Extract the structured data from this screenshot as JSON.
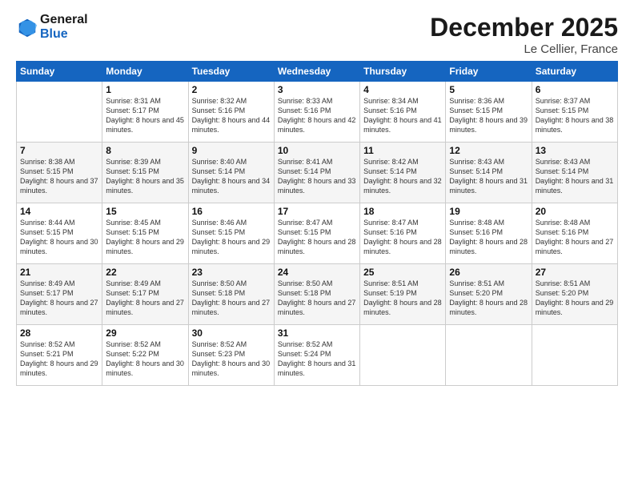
{
  "logo": {
    "line1": "General",
    "line2": "Blue"
  },
  "title": "December 2025",
  "location": "Le Cellier, France",
  "weekdays": [
    "Sunday",
    "Monday",
    "Tuesday",
    "Wednesday",
    "Thursday",
    "Friday",
    "Saturday"
  ],
  "weeks": [
    [
      {
        "day": "",
        "sunrise": "",
        "sunset": "",
        "daylight": ""
      },
      {
        "day": "1",
        "sunrise": "Sunrise: 8:31 AM",
        "sunset": "Sunset: 5:17 PM",
        "daylight": "Daylight: 8 hours and 45 minutes."
      },
      {
        "day": "2",
        "sunrise": "Sunrise: 8:32 AM",
        "sunset": "Sunset: 5:16 PM",
        "daylight": "Daylight: 8 hours and 44 minutes."
      },
      {
        "day": "3",
        "sunrise": "Sunrise: 8:33 AM",
        "sunset": "Sunset: 5:16 PM",
        "daylight": "Daylight: 8 hours and 42 minutes."
      },
      {
        "day": "4",
        "sunrise": "Sunrise: 8:34 AM",
        "sunset": "Sunset: 5:16 PM",
        "daylight": "Daylight: 8 hours and 41 minutes."
      },
      {
        "day": "5",
        "sunrise": "Sunrise: 8:36 AM",
        "sunset": "Sunset: 5:15 PM",
        "daylight": "Daylight: 8 hours and 39 minutes."
      },
      {
        "day": "6",
        "sunrise": "Sunrise: 8:37 AM",
        "sunset": "Sunset: 5:15 PM",
        "daylight": "Daylight: 8 hours and 38 minutes."
      }
    ],
    [
      {
        "day": "7",
        "sunrise": "Sunrise: 8:38 AM",
        "sunset": "Sunset: 5:15 PM",
        "daylight": "Daylight: 8 hours and 37 minutes."
      },
      {
        "day": "8",
        "sunrise": "Sunrise: 8:39 AM",
        "sunset": "Sunset: 5:15 PM",
        "daylight": "Daylight: 8 hours and 35 minutes."
      },
      {
        "day": "9",
        "sunrise": "Sunrise: 8:40 AM",
        "sunset": "Sunset: 5:14 PM",
        "daylight": "Daylight: 8 hours and 34 minutes."
      },
      {
        "day": "10",
        "sunrise": "Sunrise: 8:41 AM",
        "sunset": "Sunset: 5:14 PM",
        "daylight": "Daylight: 8 hours and 33 minutes."
      },
      {
        "day": "11",
        "sunrise": "Sunrise: 8:42 AM",
        "sunset": "Sunset: 5:14 PM",
        "daylight": "Daylight: 8 hours and 32 minutes."
      },
      {
        "day": "12",
        "sunrise": "Sunrise: 8:43 AM",
        "sunset": "Sunset: 5:14 PM",
        "daylight": "Daylight: 8 hours and 31 minutes."
      },
      {
        "day": "13",
        "sunrise": "Sunrise: 8:43 AM",
        "sunset": "Sunset: 5:14 PM",
        "daylight": "Daylight: 8 hours and 31 minutes."
      }
    ],
    [
      {
        "day": "14",
        "sunrise": "Sunrise: 8:44 AM",
        "sunset": "Sunset: 5:15 PM",
        "daylight": "Daylight: 8 hours and 30 minutes."
      },
      {
        "day": "15",
        "sunrise": "Sunrise: 8:45 AM",
        "sunset": "Sunset: 5:15 PM",
        "daylight": "Daylight: 8 hours and 29 minutes."
      },
      {
        "day": "16",
        "sunrise": "Sunrise: 8:46 AM",
        "sunset": "Sunset: 5:15 PM",
        "daylight": "Daylight: 8 hours and 29 minutes."
      },
      {
        "day": "17",
        "sunrise": "Sunrise: 8:47 AM",
        "sunset": "Sunset: 5:15 PM",
        "daylight": "Daylight: 8 hours and 28 minutes."
      },
      {
        "day": "18",
        "sunrise": "Sunrise: 8:47 AM",
        "sunset": "Sunset: 5:16 PM",
        "daylight": "Daylight: 8 hours and 28 minutes."
      },
      {
        "day": "19",
        "sunrise": "Sunrise: 8:48 AM",
        "sunset": "Sunset: 5:16 PM",
        "daylight": "Daylight: 8 hours and 28 minutes."
      },
      {
        "day": "20",
        "sunrise": "Sunrise: 8:48 AM",
        "sunset": "Sunset: 5:16 PM",
        "daylight": "Daylight: 8 hours and 27 minutes."
      }
    ],
    [
      {
        "day": "21",
        "sunrise": "Sunrise: 8:49 AM",
        "sunset": "Sunset: 5:17 PM",
        "daylight": "Daylight: 8 hours and 27 minutes."
      },
      {
        "day": "22",
        "sunrise": "Sunrise: 8:49 AM",
        "sunset": "Sunset: 5:17 PM",
        "daylight": "Daylight: 8 hours and 27 minutes."
      },
      {
        "day": "23",
        "sunrise": "Sunrise: 8:50 AM",
        "sunset": "Sunset: 5:18 PM",
        "daylight": "Daylight: 8 hours and 27 minutes."
      },
      {
        "day": "24",
        "sunrise": "Sunrise: 8:50 AM",
        "sunset": "Sunset: 5:18 PM",
        "daylight": "Daylight: 8 hours and 27 minutes."
      },
      {
        "day": "25",
        "sunrise": "Sunrise: 8:51 AM",
        "sunset": "Sunset: 5:19 PM",
        "daylight": "Daylight: 8 hours and 28 minutes."
      },
      {
        "day": "26",
        "sunrise": "Sunrise: 8:51 AM",
        "sunset": "Sunset: 5:20 PM",
        "daylight": "Daylight: 8 hours and 28 minutes."
      },
      {
        "day": "27",
        "sunrise": "Sunrise: 8:51 AM",
        "sunset": "Sunset: 5:20 PM",
        "daylight": "Daylight: 8 hours and 29 minutes."
      }
    ],
    [
      {
        "day": "28",
        "sunrise": "Sunrise: 8:52 AM",
        "sunset": "Sunset: 5:21 PM",
        "daylight": "Daylight: 8 hours and 29 minutes."
      },
      {
        "day": "29",
        "sunrise": "Sunrise: 8:52 AM",
        "sunset": "Sunset: 5:22 PM",
        "daylight": "Daylight: 8 hours and 30 minutes."
      },
      {
        "day": "30",
        "sunrise": "Sunrise: 8:52 AM",
        "sunset": "Sunset: 5:23 PM",
        "daylight": "Daylight: 8 hours and 30 minutes."
      },
      {
        "day": "31",
        "sunrise": "Sunrise: 8:52 AM",
        "sunset": "Sunset: 5:24 PM",
        "daylight": "Daylight: 8 hours and 31 minutes."
      },
      {
        "day": "",
        "sunrise": "",
        "sunset": "",
        "daylight": ""
      },
      {
        "day": "",
        "sunrise": "",
        "sunset": "",
        "daylight": ""
      },
      {
        "day": "",
        "sunrise": "",
        "sunset": "",
        "daylight": ""
      }
    ]
  ]
}
